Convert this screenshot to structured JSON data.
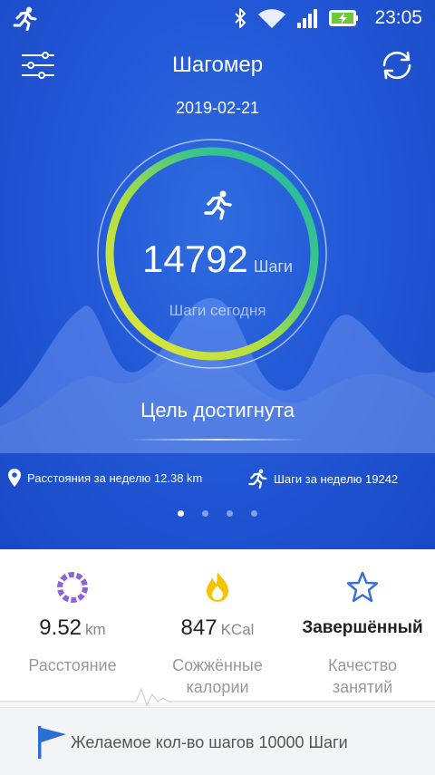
{
  "status_bar": {
    "time": "23:05"
  },
  "app_bar": {
    "title": "Шагомер"
  },
  "date": "2019-02-21",
  "today": {
    "steps": "14792",
    "steps_unit": "Шаги",
    "subtitle": "Шаги сегодня",
    "goal_progress": 1.0
  },
  "goal_status": "Цель достигнута",
  "weekly": {
    "distance_text": "Расстояния за неделю 12.38 km",
    "steps_text": "Шаги за неделю 19242"
  },
  "pager": {
    "pages": 4,
    "active": 0
  },
  "stats": [
    {
      "value": "9.52",
      "unit": "km",
      "label": "Расстояние",
      "icon": "distance-icon"
    },
    {
      "value": "847",
      "unit": "KCal",
      "label_line1": "Сожжённые",
      "label_line2": "калории",
      "icon": "flame-icon"
    },
    {
      "value": "Завершённый",
      "label_line1": "Качество",
      "label_line2": "занятий",
      "icon": "star-icon"
    }
  ],
  "footer": {
    "goal_text": "Желаемое кол-во шагов 10000 Шаги"
  },
  "colors": {
    "hero_blue": "#2258d6",
    "ring_yellow": "#e8e63a",
    "ring_teal": "#1fb8a6",
    "accent_purple": "#8f62d8",
    "flame": "#f5c400",
    "star": "#3b6fd8"
  }
}
